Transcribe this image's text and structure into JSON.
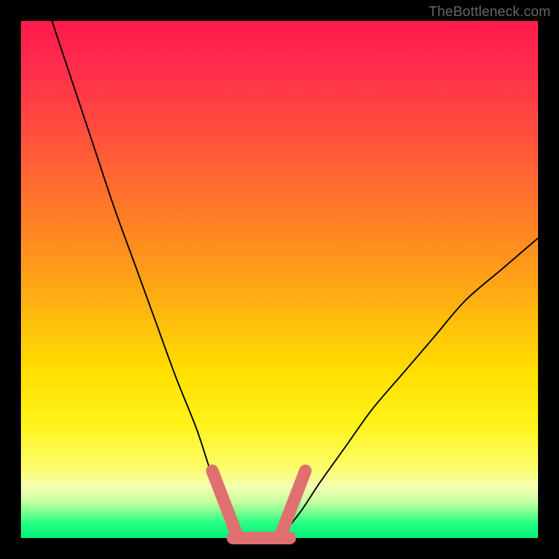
{
  "watermark": "TheBottleneck.com",
  "colors": {
    "background": "#000000",
    "gradient_top": "#ff1a4d",
    "gradient_mid": "#ffe000",
    "gradient_bottom": "#00ef78",
    "curve": "#000000",
    "marker": "#e07070"
  },
  "chart_data": {
    "type": "line",
    "title": "",
    "xlabel": "",
    "ylabel": "",
    "xlim": [
      0,
      100
    ],
    "ylim": [
      0,
      100
    ],
    "series": [
      {
        "name": "left-curve",
        "x": [
          6,
          10,
          14,
          18,
          22,
          26,
          30,
          34,
          37,
          40,
          42
        ],
        "y": [
          100,
          88,
          76,
          64,
          53,
          42,
          31,
          21,
          12,
          5,
          0
        ]
      },
      {
        "name": "right-curve",
        "x": [
          50,
          54,
          58,
          63,
          68,
          74,
          80,
          86,
          93,
          100
        ],
        "y": [
          0,
          5,
          11,
          18,
          25,
          32,
          39,
          46,
          52,
          58
        ]
      },
      {
        "name": "marker-left-diagonal",
        "x": [
          37,
          42
        ],
        "y": [
          13,
          0
        ]
      },
      {
        "name": "marker-bottom-flat",
        "x": [
          41,
          52
        ],
        "y": [
          0,
          0
        ]
      },
      {
        "name": "marker-right-diagonal",
        "x": [
          50,
          55
        ],
        "y": [
          0,
          13
        ]
      }
    ]
  }
}
